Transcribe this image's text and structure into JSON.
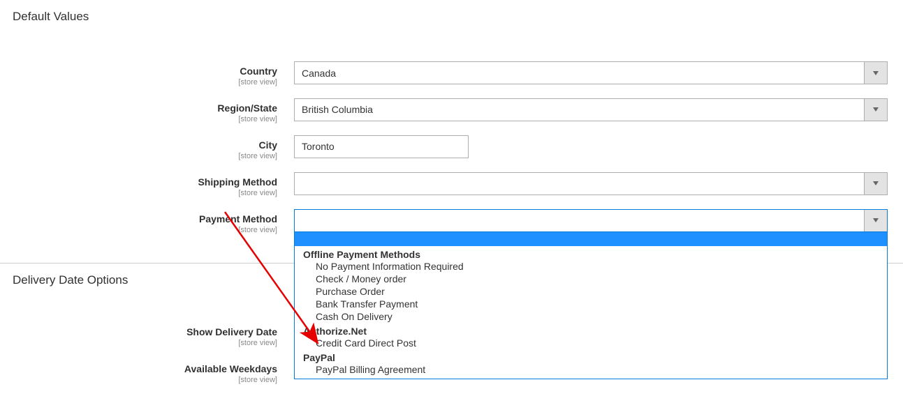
{
  "sections": {
    "default_values": "Default Values",
    "delivery_options": "Delivery Date Options"
  },
  "scope_label": "[store view]",
  "fields": {
    "country": {
      "label": "Country",
      "value": "Canada"
    },
    "region": {
      "label": "Region/State",
      "value": "British Columbia"
    },
    "city": {
      "label": "City",
      "value": "Toronto"
    },
    "shipping": {
      "label": "Shipping Method",
      "value": ""
    },
    "payment": {
      "label": "Payment Method",
      "value": ""
    },
    "show_date": {
      "label": "Show Delivery Date"
    },
    "weekdays": {
      "label": "Available Weekdays"
    }
  },
  "payment_dropdown": {
    "g1": "Offline Payment Methods",
    "g1o1": "No Payment Information Required",
    "g1o2": "Check / Money order",
    "g1o3": "Purchase Order",
    "g1o4": "Bank Transfer Payment",
    "g1o5": "Cash On Delivery",
    "g2": "Authorize.Net",
    "g2o1": "Credit Card Direct Post",
    "g3": "PayPal",
    "g3o1": "PayPal Billing Agreement"
  }
}
